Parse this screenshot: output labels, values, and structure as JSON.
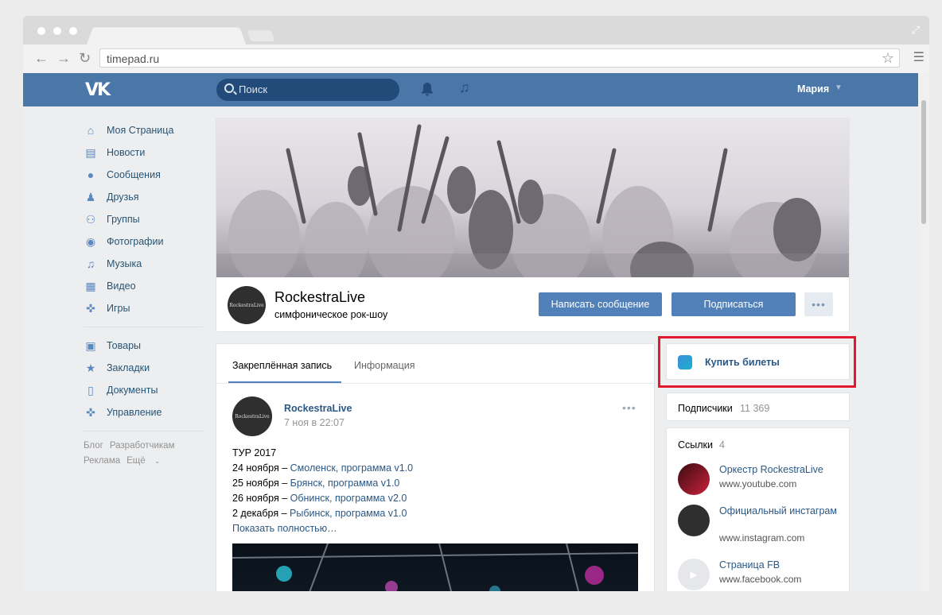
{
  "browser": {
    "url": "timepad.ru"
  },
  "vk_header": {
    "logo": "VK",
    "search_placeholder": "Поиск",
    "user_name": "Мария"
  },
  "sidebar": {
    "items": [
      {
        "label": "Моя Страница",
        "icon": "home-icon"
      },
      {
        "label": "Новости",
        "icon": "news-icon"
      },
      {
        "label": "Сообщения",
        "icon": "messages-icon"
      },
      {
        "label": "Друзья",
        "icon": "friends-icon"
      },
      {
        "label": "Группы",
        "icon": "groups-icon"
      },
      {
        "label": "Фотографии",
        "icon": "camera-icon"
      },
      {
        "label": "Музыка",
        "icon": "music-icon"
      },
      {
        "label": "Видео",
        "icon": "video-icon"
      },
      {
        "label": "Игры",
        "icon": "gamepad-icon"
      }
    ],
    "items2": [
      {
        "label": "Товары",
        "icon": "bag-icon"
      },
      {
        "label": "Закладки",
        "icon": "star-icon"
      },
      {
        "label": "Документы",
        "icon": "document-icon"
      },
      {
        "label": "Управление",
        "icon": "gamepad-icon"
      }
    ],
    "footer": {
      "blog": "Блог",
      "developers": "Разработчикам",
      "ads": "Реклама",
      "more": "Ещё"
    }
  },
  "group": {
    "avatar_text": "RockestraLive",
    "name": "RockestraLive",
    "status": "симфоническое рок-шоу",
    "btn_message": "Написать сообщение",
    "btn_subscribe": "Подписаться",
    "btn_more": "•••"
  },
  "wall": {
    "tabs": [
      "Закреплённая запись",
      "Информация"
    ],
    "post": {
      "author": "RockestraLive",
      "date": "7 ноя в 22:07",
      "menu": "•••",
      "title": "ТУР 2017",
      "lines": [
        {
          "date": "24 ноября – ",
          "link": "Смоленск, программа v1.0"
        },
        {
          "date": "25 ноября – ",
          "link": "Брянск, программа v1.0"
        },
        {
          "date": "26 ноября – ",
          "link": "Обнинск, программа v2.0"
        },
        {
          "date": "2 декабря – ",
          "link": "Рыбинск, программа v1.0"
        }
      ],
      "show_more": "Показать полностью…"
    }
  },
  "right": {
    "buy_tickets": "Купить билеты",
    "subscribers_label": "Подписчики",
    "subscribers_count": "11 369",
    "links_title": "Ссылки",
    "links_count": "4",
    "links": [
      {
        "title": "Оркестр RockestraLive",
        "url": "www.youtube.com"
      },
      {
        "title": "Официальный инстаграм",
        "url": "www.instagram.com"
      },
      {
        "title": "Страница FB",
        "url": "www.facebook.com"
      }
    ]
  },
  "colors": {
    "vk_blue": "#4a76a8",
    "button_blue": "#5181b8",
    "link_blue": "#2a5885",
    "highlight_red": "#e4172f"
  }
}
